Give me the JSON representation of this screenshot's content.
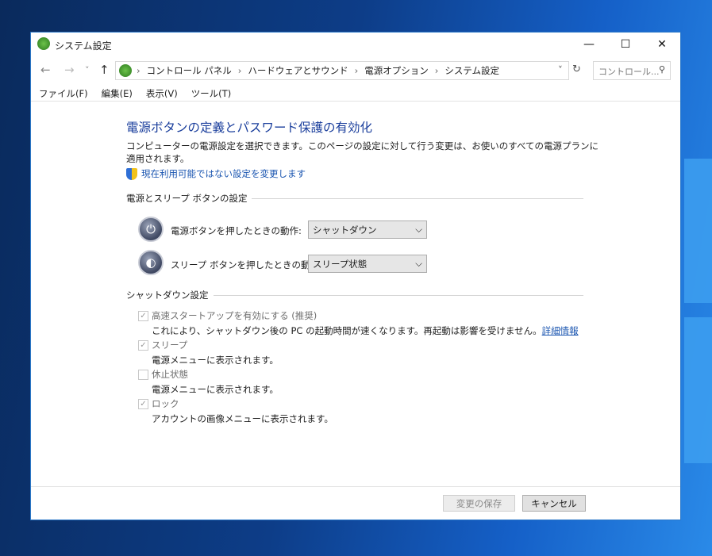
{
  "window": {
    "title": "システム設定",
    "min": "—",
    "max": "☐",
    "close": "✕"
  },
  "nav": {
    "back": "←",
    "forward": "→",
    "recent": "˅",
    "up": "↑",
    "refresh": "↻",
    "dropdown": "˅"
  },
  "breadcrumb": [
    "コントロール パネル",
    "ハードウェアとサウンド",
    "電源オプション",
    "システム設定"
  ],
  "search": {
    "placeholder": "コントロール...",
    "icon": "⚲"
  },
  "menu": [
    "ファイル(F)",
    "編集(E)",
    "表示(V)",
    "ツール(T)"
  ],
  "main": {
    "heading": "電源ボタンの定義とパスワード保護の有効化",
    "description": "コンピューターの電源設定を選択できます。このページの設定に対して行う変更は、お使いのすべての電源プランに適用されます。",
    "admin_link": "現在利用可能ではない設定を変更します",
    "group1": "電源とスリープ ボタンの設定",
    "power_label": "電源ボタンを押したときの動作:",
    "power_value": "シャットダウン",
    "sleep_label": "スリープ ボタンを押したときの動作:",
    "sleep_value": "スリープ状態",
    "group2": "シャットダウン設定",
    "options": [
      {
        "label": "高速スタートアップを有効にする (推奨)",
        "desc": "これにより、シャットダウン後の PC の起動時間が速くなります。再起動は影響を受けません。",
        "link": "詳細情報",
        "checked": true
      },
      {
        "label": "スリープ",
        "desc": "電源メニューに表示されます。",
        "checked": true
      },
      {
        "label": "休止状態",
        "desc": "電源メニューに表示されます。",
        "checked": false
      },
      {
        "label": "ロック",
        "desc": "アカウントの画像メニューに表示されます。",
        "checked": true
      }
    ]
  },
  "footer": {
    "save": "変更の保存",
    "cancel": "キャンセル"
  },
  "chev": "⌵",
  "check": "✓"
}
